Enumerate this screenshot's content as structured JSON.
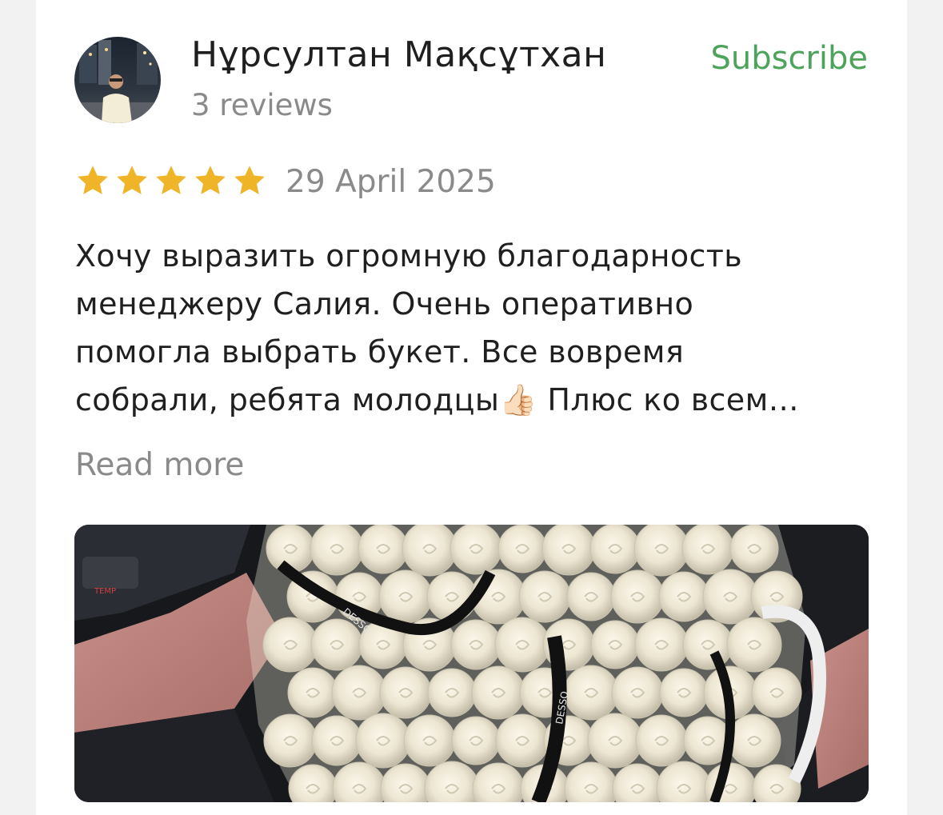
{
  "review": {
    "author_name": "Нұрсултан Мақсұтхан",
    "review_count": "3 reviews",
    "subscribe_label": "Subscribe",
    "rating": 5,
    "rating_max": 5,
    "date": "29 April 2025",
    "text_lines": [
      "Хочу выразить огромную благодарность",
      "менеджеру Салия. Очень оперативно",
      "помогла выбрать букет. Все вовремя",
      "собрали, ребята молодцы👍🏻 Плюс ко всем…"
    ],
    "read_more_label": "Read more",
    "photo_text": {
      "ribbon_brand": "DESSO"
    }
  },
  "colors": {
    "accent_green": "#4ca35a",
    "star_gold": "#f0b429",
    "secondary_text": "#8a8a8a",
    "primary_text": "#1f1f1f"
  },
  "icons": {
    "star": "star-icon",
    "avatar": "user-avatar"
  }
}
